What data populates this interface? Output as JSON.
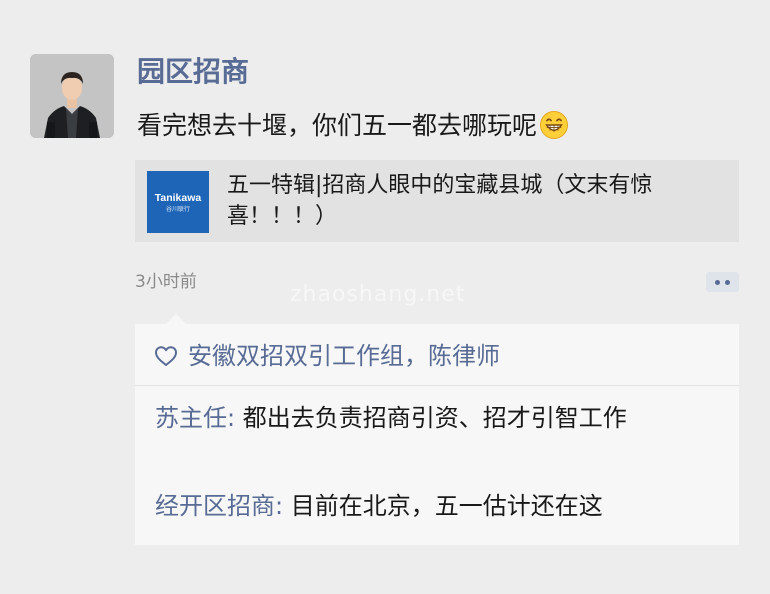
{
  "post": {
    "author": "园区招商",
    "text": "看完想去十堰，你们五一都去哪玩呢",
    "emoji": "grinning-face-emoji",
    "time": "3小时前",
    "watermark": "zhaoshang.net",
    "share": {
      "brand": "Tanikawa",
      "brand_sub": "谷川联行",
      "title": "五一特辑|招商人眼中的宝藏县城（文末有惊喜！！！）"
    }
  },
  "likes": {
    "icon": "heart-outline-icon",
    "names": "安徽双招双引工作组，陈律师"
  },
  "comments": [
    {
      "author": "苏主任",
      "separator": ": ",
      "text": "都出去负责招商引资、招才引智工作"
    },
    {
      "author": "经开区招商",
      "separator": ": ",
      "text": "目前在北京，五一估计还在这"
    }
  ],
  "colors": {
    "link": "#576b95",
    "background": "#ededed",
    "panel": "#f7f7f7",
    "card": "#e2e2e2",
    "thumb": "#1e65b8"
  }
}
